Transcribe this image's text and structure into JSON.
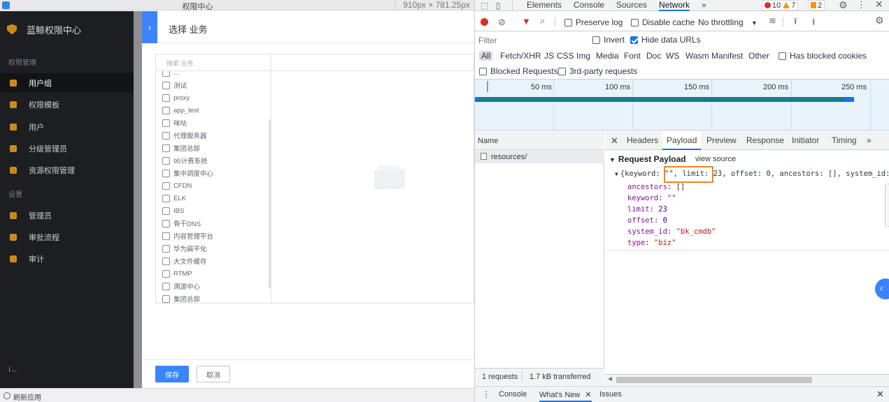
{
  "app": {
    "title": "权限中心",
    "size_readout": "910px × 781.25px",
    "brand": "蓝鲸权限中心",
    "sidebar": {
      "group1": "权限管理",
      "items1": [
        {
          "label": "用户组",
          "active": true
        },
        {
          "label": "权限模板"
        },
        {
          "label": "用户"
        },
        {
          "label": "分级管理员"
        },
        {
          "label": "资源权限管理"
        }
      ],
      "group2": "设置",
      "items2": [
        {
          "label": "管理员"
        },
        {
          "label": "审批流程"
        },
        {
          "label": "审计"
        }
      ],
      "collapse": "I←"
    },
    "panel": {
      "arrow": "›",
      "title": "选择 业务",
      "search_placeholder": "搜索 业务",
      "options": [
        "…",
        "测试",
        "proxy",
        "app_test",
        "咪咕",
        "代理服务器",
        "集团总部",
        "95计费系统",
        "集中调度中心",
        "CFDN",
        "ELK",
        "IBS",
        "骨干DNS",
        "内容管理平台",
        "华为扁平化",
        "大文件缓存",
        "RTMP",
        "溯源中心",
        "集团总部"
      ]
    },
    "footer": {
      "save": "保存",
      "cancel": "取消"
    },
    "status": "刷新应用"
  },
  "devtools": {
    "tabs": [
      "Elements",
      "Console",
      "Sources",
      "Network"
    ],
    "active_tab": "Network",
    "more": "»",
    "errors": "10",
    "warnings": "7",
    "issues": "2",
    "toolbar": {
      "preserve_log": "Preserve log",
      "disable_cache": "Disable cache",
      "throttling": "No throttling"
    },
    "filter": {
      "placeholder": "Filter",
      "invert": "Invert",
      "hide_data_urls": "Hide data URLs",
      "types": [
        "All",
        "Fetch/XHR",
        "JS",
        "CSS",
        "Img",
        "Media",
        "Font",
        "Doc",
        "WS",
        "Wasm",
        "Manifest",
        "Other"
      ],
      "has_blocked_cookies": "Has blocked cookies",
      "blocked_requests": "Blocked Requests",
      "third_party": "3rd-party requests"
    },
    "timeline": {
      "ticks": [
        "50 ms",
        "100 ms",
        "150 ms",
        "200 ms",
        "250 ms"
      ]
    },
    "request_list": {
      "header": "Name",
      "rows": [
        "resources/"
      ]
    },
    "detail_tabs": [
      "Headers",
      "Payload",
      "Preview",
      "Response",
      "Initiator",
      "Timing"
    ],
    "active_detail_tab": "Payload",
    "payload": {
      "section": "Request Payload",
      "view_source": "view source",
      "summary_start": "{keyword: \"\", ",
      "summary_highlight": "limit: 23,",
      "summary_end": " offset: 0, ancestors: [], system_id:",
      "fields": [
        {
          "k": "ancestors",
          "v": "[]"
        },
        {
          "k": "keyword",
          "v": "\"\""
        },
        {
          "k": "limit",
          "v": "23"
        },
        {
          "k": "offset",
          "v": "0"
        },
        {
          "k": "system_id",
          "v": "\"bk_cmdb\""
        },
        {
          "k": "type",
          "v": "\"biz\""
        }
      ]
    },
    "summary": {
      "requests": "1 requests",
      "transferred": "1.7 kB transferred"
    },
    "drawer": {
      "tabs": [
        "Console",
        "What's New",
        "Issues"
      ]
    },
    "accent": "#1a73e8",
    "highlight_color": "#f0861f"
  }
}
